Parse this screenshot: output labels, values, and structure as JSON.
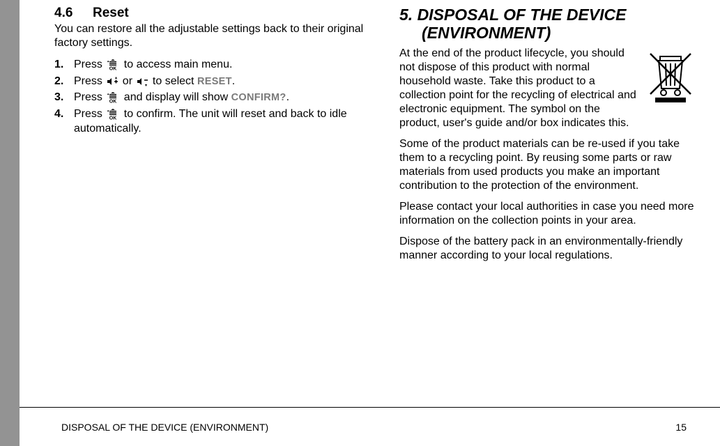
{
  "left": {
    "heading_num": "4.6",
    "heading_title": "Reset",
    "intro": "You can restore all the adjustable settings back to their original factory settings.",
    "steps": [
      {
        "pre": "Press ",
        "icon": "ok",
        "post": " to access main menu."
      },
      {
        "pre": "Press ",
        "icon": "up",
        "mid": " or ",
        "icon2": "down",
        "post2": " to select ",
        "disp": "RESET",
        "post3": "."
      },
      {
        "pre": "Press ",
        "icon": "ok",
        "post": " and display will show ",
        "disp": "CONFIRM?",
        "post3": "."
      },
      {
        "pre": "Press ",
        "icon": "ok",
        "post": " to confirm. The unit will reset and back to idle automatically."
      }
    ]
  },
  "right": {
    "heading_line1": "5. DISPOSAL OF THE DEVICE",
    "heading_line2": "(ENVIRONMENT)",
    "p1": "At the end of the product lifecycle, you should not dispose of this product with normal household waste. Take this product to a collection point for the recycling of electrical and electronic equipment. The symbol on the product, user's guide and/or box indicates this.",
    "p2": "Some of the product materials can be re-used if you take them to a recycling point. By reusing some parts or raw materials from used products you make an important contribution to the protection of the environment.",
    "p3": "Please contact your local authorities in case you need more information on the collection points in your area.",
    "p4": "Dispose of the battery pack in an environmentally-friendly manner according to your local regulations."
  },
  "footer": {
    "title": "DISPOSAL OF THE DEVICE (ENVIRONMENT)",
    "page": "15"
  }
}
